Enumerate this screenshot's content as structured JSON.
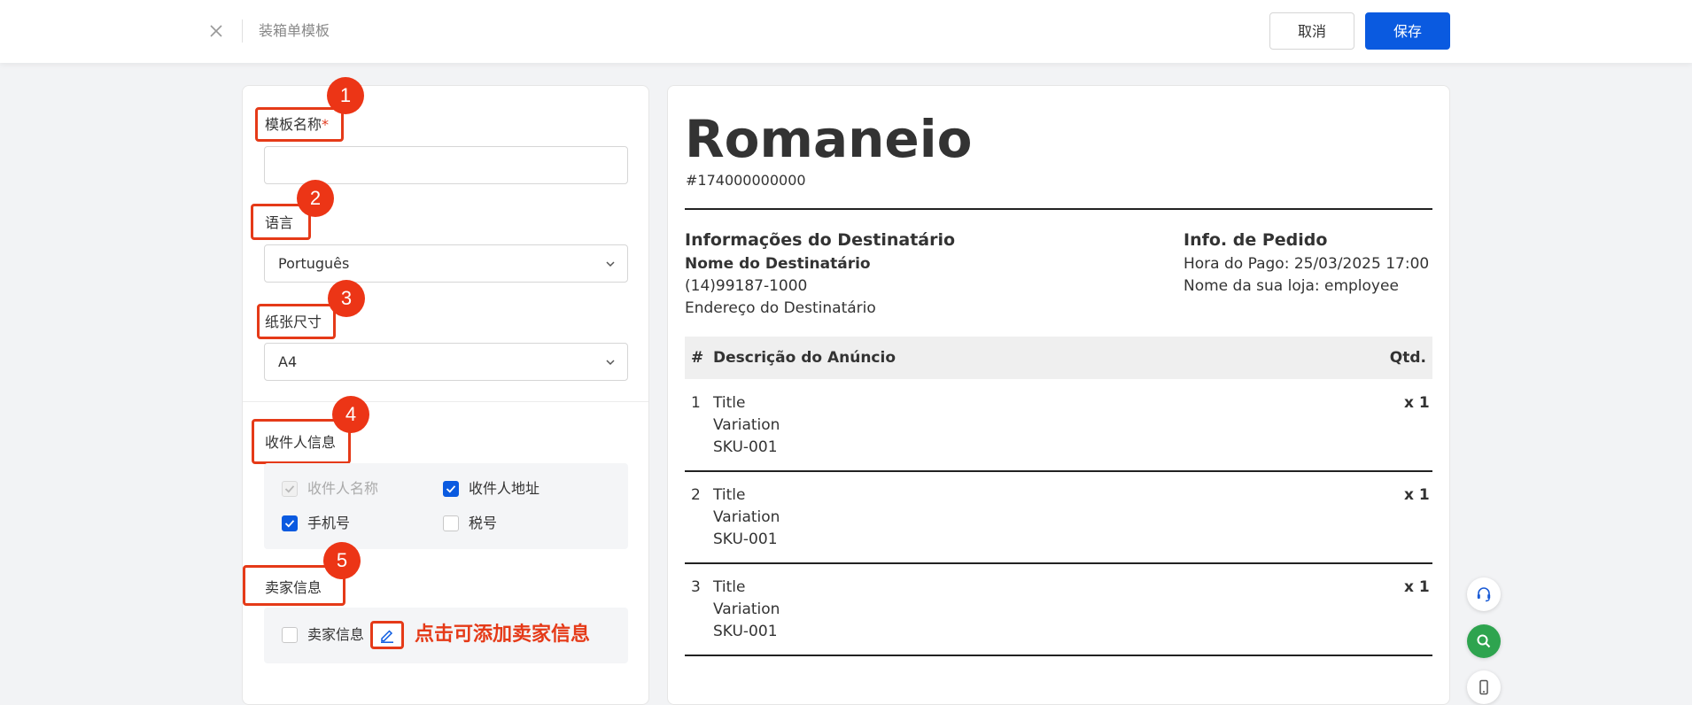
{
  "header": {
    "title": "装箱单模板",
    "cancel_label": "取消",
    "save_label": "保存"
  },
  "form": {
    "template_name": {
      "label": "模板名称",
      "required_mark": "*",
      "value": "",
      "badge": "1"
    },
    "language": {
      "label": "语言",
      "value": "Português",
      "badge": "2"
    },
    "paper_size": {
      "label": "纸张尺寸",
      "value": "A4",
      "badge": "3"
    },
    "recipient": {
      "label": "收件人信息",
      "badge": "4",
      "options": [
        {
          "label": "收件人名称",
          "checked": true,
          "disabled": true
        },
        {
          "label": "收件人地址",
          "checked": true,
          "disabled": false
        },
        {
          "label": "手机号",
          "checked": true,
          "disabled": false
        },
        {
          "label": "税号",
          "checked": false,
          "disabled": false
        }
      ]
    },
    "seller": {
      "label": "卖家信息",
      "badge": "5",
      "option_label": "卖家信息",
      "checked": false,
      "hint": "点击可添加卖家信息"
    }
  },
  "preview": {
    "title": "Romaneio",
    "order_no": "#174000000000",
    "recipient_heading": "Informações do Destinatário",
    "recipient_name": "Nome do Destinatário",
    "recipient_phone": "(14)99187-1000",
    "recipient_address": "Endereço do Destinatário",
    "order_heading": "Info. de Pedido",
    "paid_time": "Hora do Pago: 25/03/2025 17:00",
    "store_name": "Nome da sua loja: employee",
    "table": {
      "headers": [
        "#",
        "Descrição do Anúncio",
        "Qtd."
      ],
      "rows": [
        {
          "index": "1",
          "title": "Title",
          "variation": "Variation",
          "sku": "SKU-001",
          "qty": "x 1"
        },
        {
          "index": "2",
          "title": "Title",
          "variation": "Variation",
          "sku": "SKU-001",
          "qty": "x 1"
        },
        {
          "index": "3",
          "title": "Title",
          "variation": "Variation",
          "sku": "SKU-001",
          "qty": "x 1"
        }
      ]
    }
  },
  "side_buttons": [
    "headset-icon",
    "search-icon",
    "mobile-icon"
  ],
  "colors": {
    "primary": "#0a5ae0",
    "annotation": "#e53a18",
    "success": "#2ea44f"
  }
}
